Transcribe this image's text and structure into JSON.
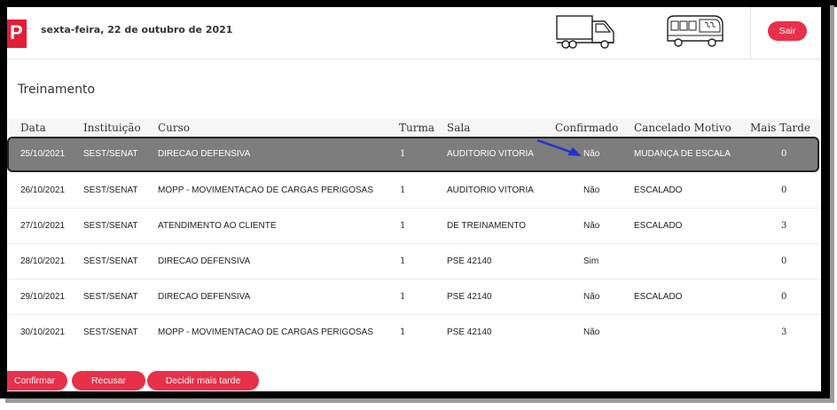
{
  "header": {
    "logo_letter": "P",
    "date": "sexta-feira, 22 de outubro de 2021",
    "logout_label": "Sair"
  },
  "page": {
    "title": "Treinamento"
  },
  "table": {
    "columns": [
      "Data",
      "Instituição",
      "Curso",
      "Turma",
      "Sala",
      "Confirmado",
      "Cancelado Motivo",
      "Mais Tarde"
    ],
    "rows": [
      [
        "25/10/2021",
        "SEST/SENAT",
        "DIRECAO DEFENSIVA",
        "1",
        "AUDITORIO VITORIA",
        "Não",
        "MUDANÇA DE ESCALA",
        "0"
      ],
      [
        "26/10/2021",
        "SEST/SENAT",
        "MOPP - MOVIMENTACAO DE CARGAS PERIGOSAS",
        "1",
        "AUDITORIO VITORIA",
        "Não",
        "ESCALADO",
        "0"
      ],
      [
        "27/10/2021",
        "SEST/SENAT",
        "ATENDIMENTO AO CLIENTE",
        "1",
        "DE TREINAMENTO",
        "Não",
        "ESCALADO",
        "3"
      ],
      [
        "28/10/2021",
        "SEST/SENAT",
        "DIRECAO DEFENSIVA",
        "1",
        "PSE 42140",
        "Sim",
        "",
        "0"
      ],
      [
        "29/10/2021",
        "SEST/SENAT",
        "DIRECAO DEFENSIVA",
        "1",
        "PSE 42140",
        "Não",
        "ESCALADO",
        "0"
      ],
      [
        "30/10/2021",
        "SEST/SENAT",
        "MOPP - MOVIMENTACAO DE CARGAS PERIGOSAS",
        "1",
        "PSE 42140",
        "Não",
        "",
        "3"
      ]
    ],
    "selected_row": 0
  },
  "actions": {
    "confirm_label": "Confirmar",
    "refuse_label": "Recusar",
    "later_label": "Decidir mais tarde"
  },
  "icons": {
    "logo": "brand-logo-icon",
    "truck": "truck-icon",
    "bus": "bus-icon",
    "pointer": "arrow-pointer-icon"
  },
  "colors": {
    "accent": "#e8304a",
    "selected_row": "#7d7d7d",
    "arrow": "#2233cc"
  }
}
